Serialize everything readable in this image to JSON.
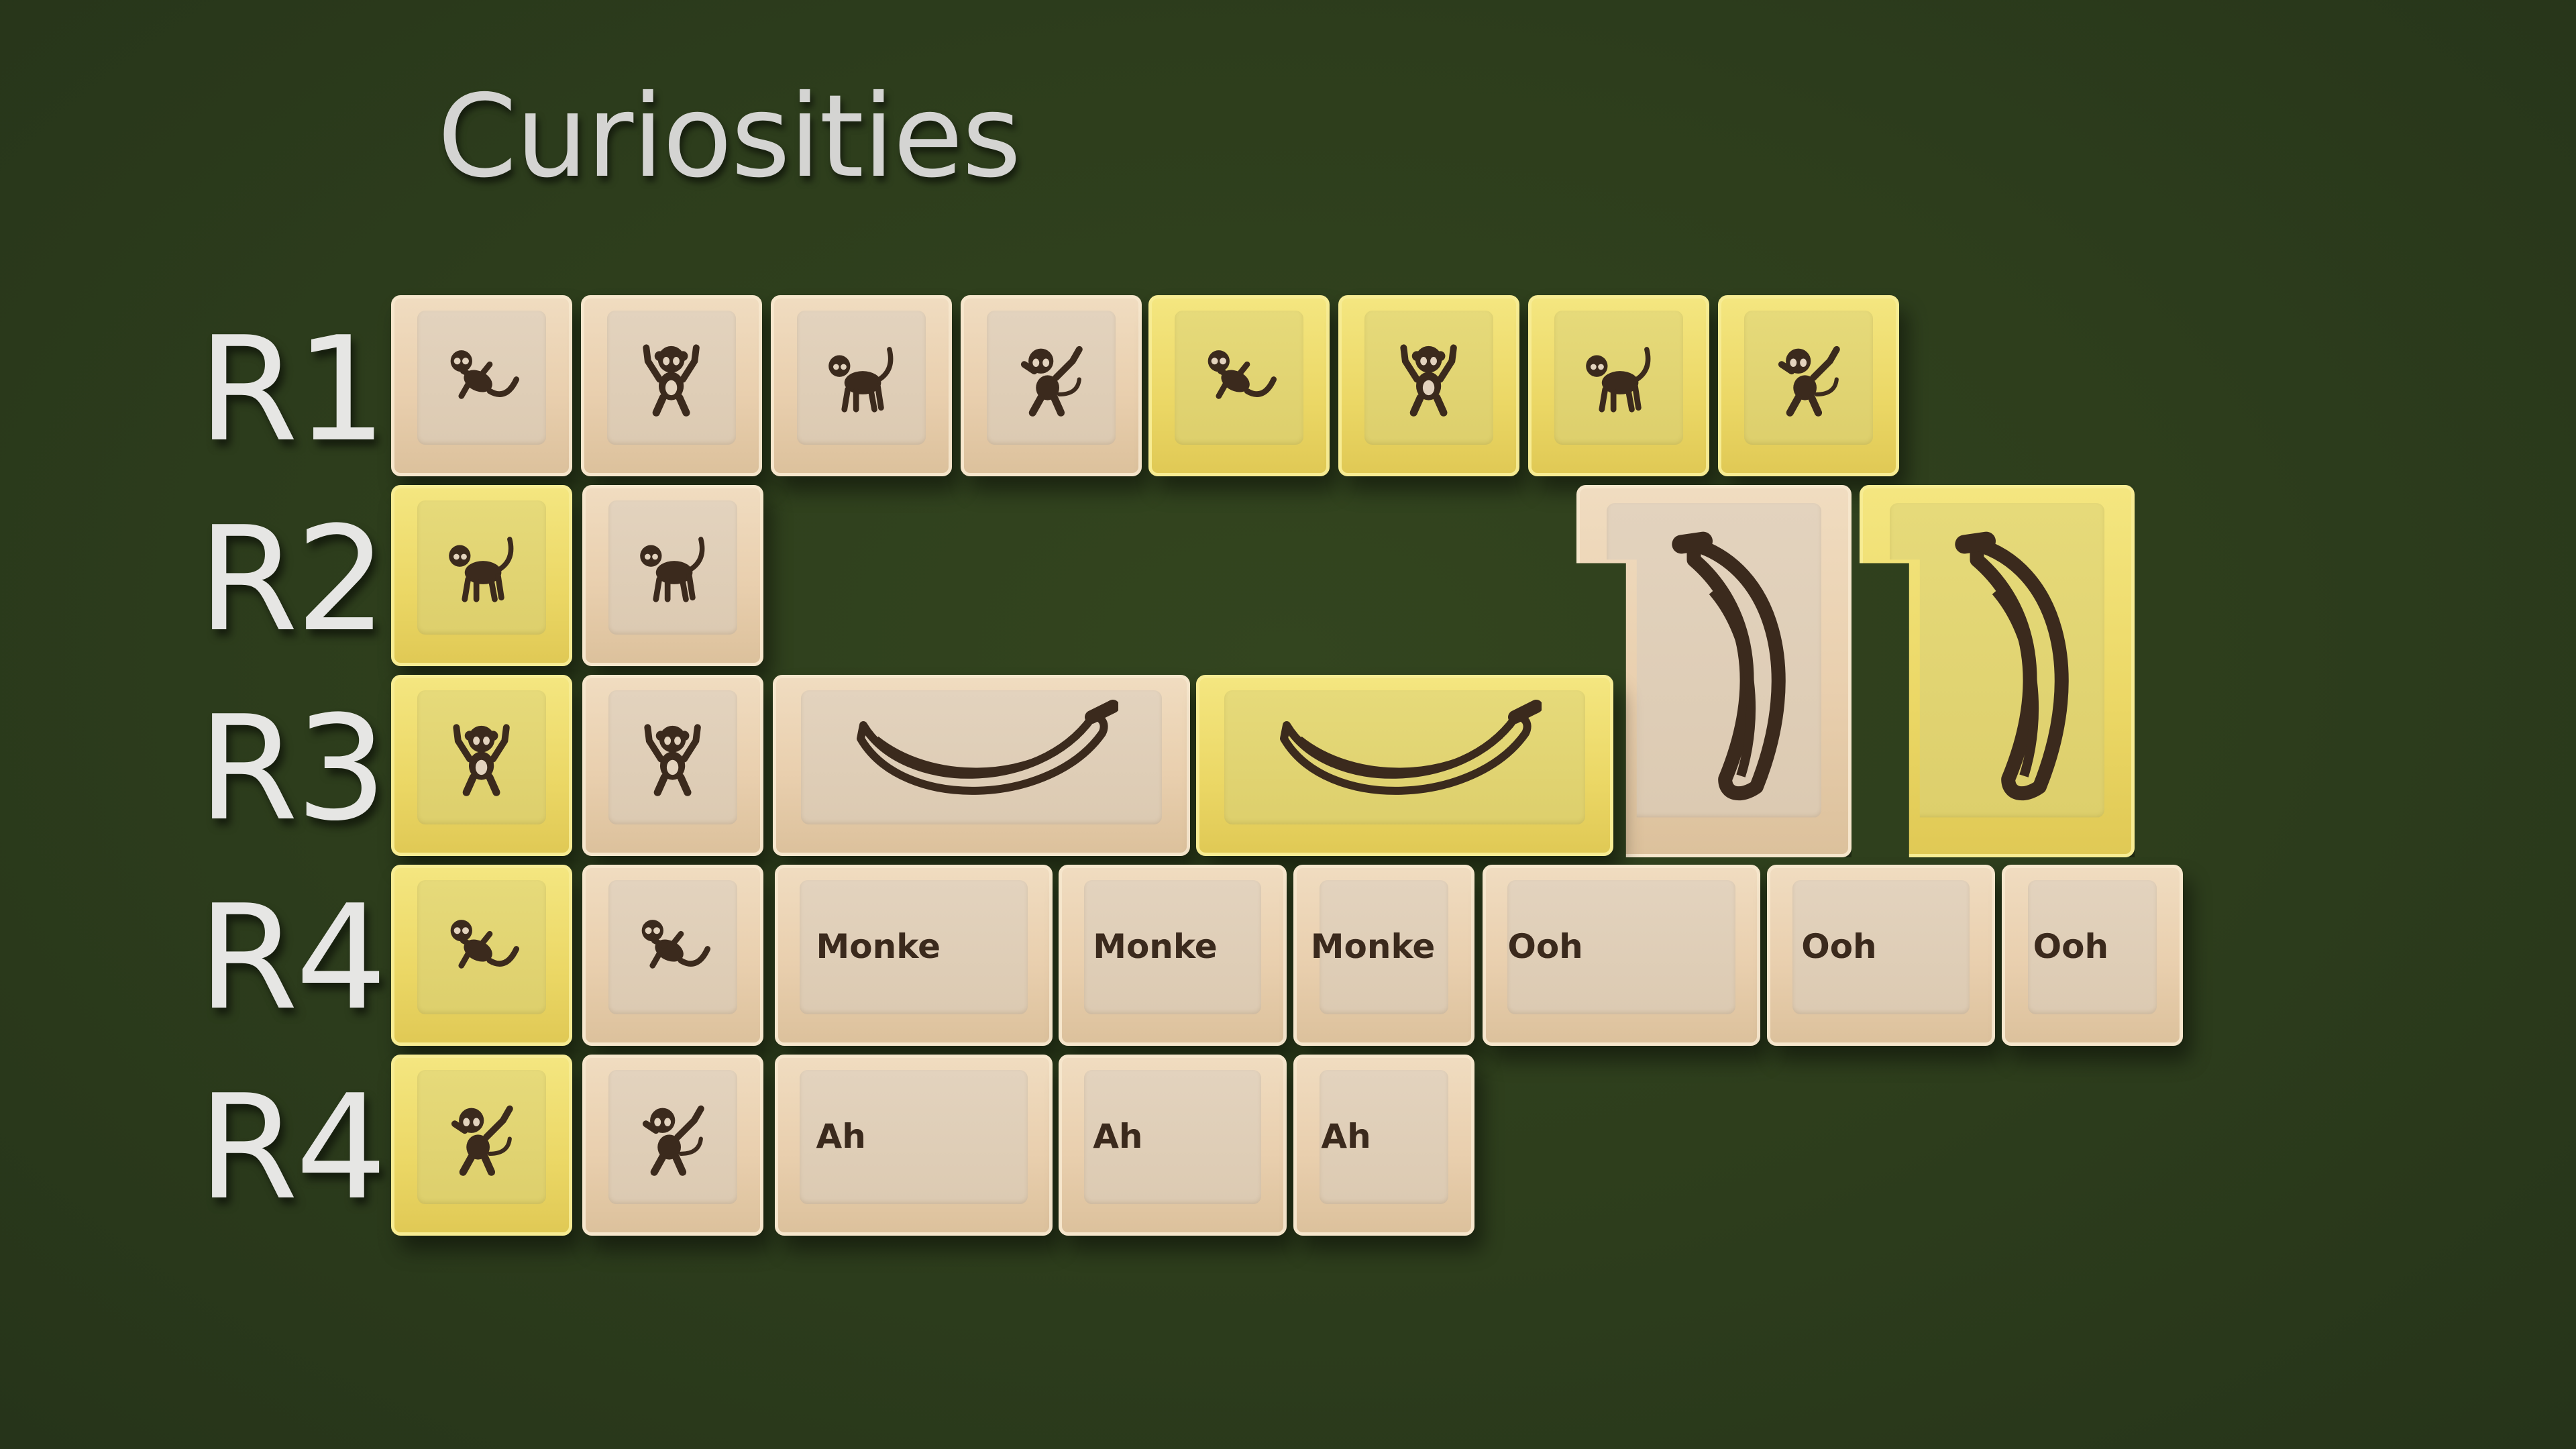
{
  "title": "Curiosities",
  "row_labels": [
    "R1",
    "R2",
    "R3",
    "R4",
    "R4"
  ],
  "keys": {
    "r4_monke": "Monke",
    "r4_ooh": "Ooh",
    "r5_ah": "Ah"
  },
  "colors": {
    "background": "#2d3d1c",
    "beige_keycap": "#e9cfae",
    "yellow_keycap": "#ebd765",
    "legend": "#3b2a1d"
  },
  "icons": {
    "monkey_lying": "monkey-lying-icon",
    "monkey_arms_up": "monkey-arms-up-icon",
    "monkey_walking": "monkey-walking-icon",
    "monkey_dab": "monkey-dab-icon",
    "banana": "banana-icon"
  }
}
